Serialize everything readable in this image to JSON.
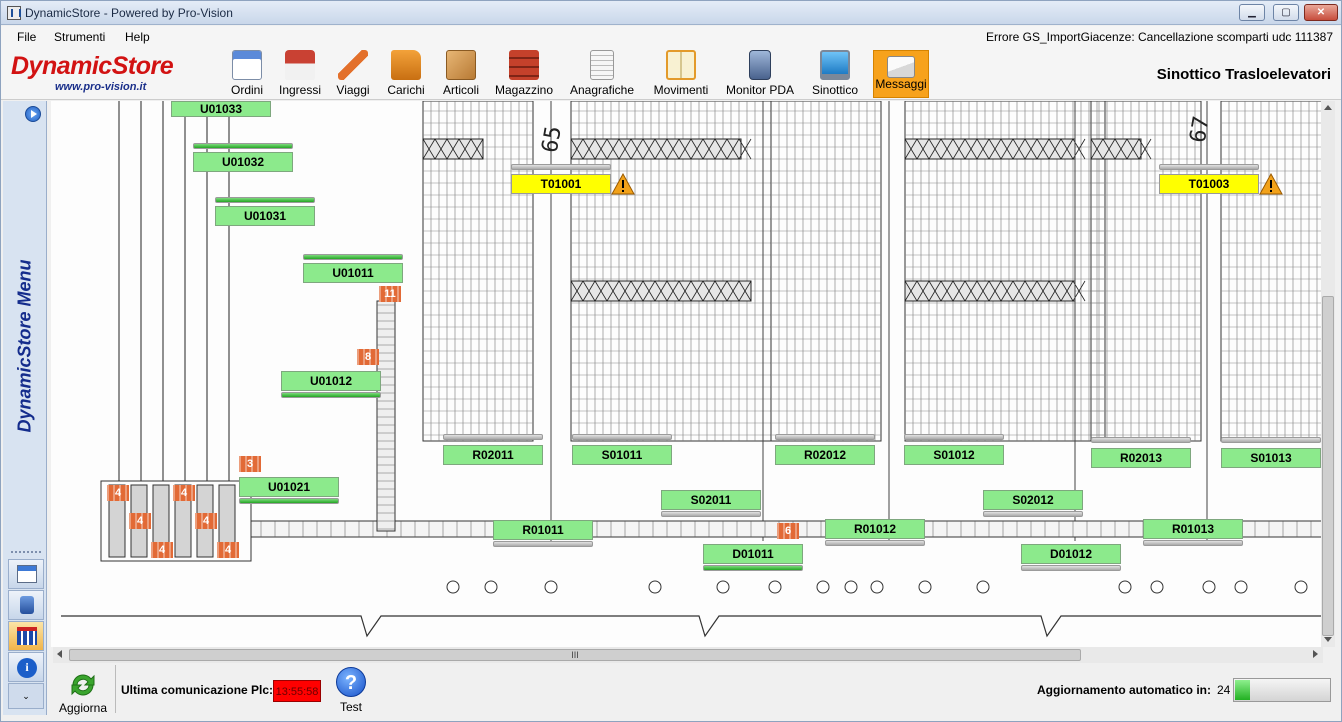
{
  "window": {
    "title": "DynamicStore - Powered by Pro-Vision"
  },
  "menu": {
    "file": "File",
    "tools": "Strumenti",
    "help": "Help",
    "error_message": "Errore GS_ImportGiacenze: Cancellazione scomparti udc 111387"
  },
  "logo": {
    "name": "DynamicStore",
    "site": "www.pro-vision.it"
  },
  "toolbar": {
    "items": [
      {
        "label": "Ordini",
        "icon": "orders-icon"
      },
      {
        "label": "Ingressi",
        "icon": "house-arrow-icon"
      },
      {
        "label": "Viaggi",
        "icon": "plane-icon"
      },
      {
        "label": "Carichi",
        "icon": "truck-icon"
      },
      {
        "label": "Articoli",
        "icon": "box-icon"
      },
      {
        "label": "Magazzino",
        "icon": "warehouse-icon"
      },
      {
        "label": "Anagrafiche",
        "icon": "document-icon"
      },
      {
        "label": "Movimenti",
        "icon": "book-icon"
      },
      {
        "label": "Monitor PDA",
        "icon": "pda-icon"
      },
      {
        "label": "Sinottico",
        "icon": "monitor-icon"
      },
      {
        "label": "Messaggi",
        "icon": "envelope-icon",
        "active": true
      }
    ]
  },
  "page_heading": "Sinottico Trasloelevatori",
  "side_menu": {
    "title": "DynamicStore Menu"
  },
  "labels": {
    "U01033": "U01033",
    "U01032": "U01032",
    "U01031": "U01031",
    "U01011": "U01011",
    "U01012": "U01012",
    "U01021": "U01021",
    "T01001": "T01001",
    "T01003": "T01003",
    "R02011": "R02011",
    "S01011": "S01011",
    "R02012": "R02012",
    "S01012": "S01012",
    "R02013": "R02013",
    "S01013": "S01013",
    "S02011": "S02011",
    "S02012": "S02012",
    "R01011": "R01011",
    "R01012": "R01012",
    "R01013": "R01013",
    "D01011": "D01011",
    "D01012": "D01012"
  },
  "counters": [
    "11",
    "8",
    "3",
    "4",
    "4",
    "4",
    "4",
    "4",
    "4",
    "4",
    "6"
  ],
  "drawing_marks": [
    "65",
    "67"
  ],
  "scrollbar": {
    "grip": "III"
  },
  "status": {
    "refresh_label": "Aggiorna",
    "plc_label": "Ultima comunicazione Plc:",
    "plc_time": "13:55:58",
    "test_label": "Test",
    "auto_label": "Aggiornamento automatico in:",
    "auto_seconds": "24",
    "auto_progress": 0.16
  },
  "colors": {
    "ok": "#8cea8c",
    "alert": "#ffff00",
    "logo": "#d21212",
    "active_tool": "#f7a21c",
    "plc_alarm": "#ff0000"
  }
}
